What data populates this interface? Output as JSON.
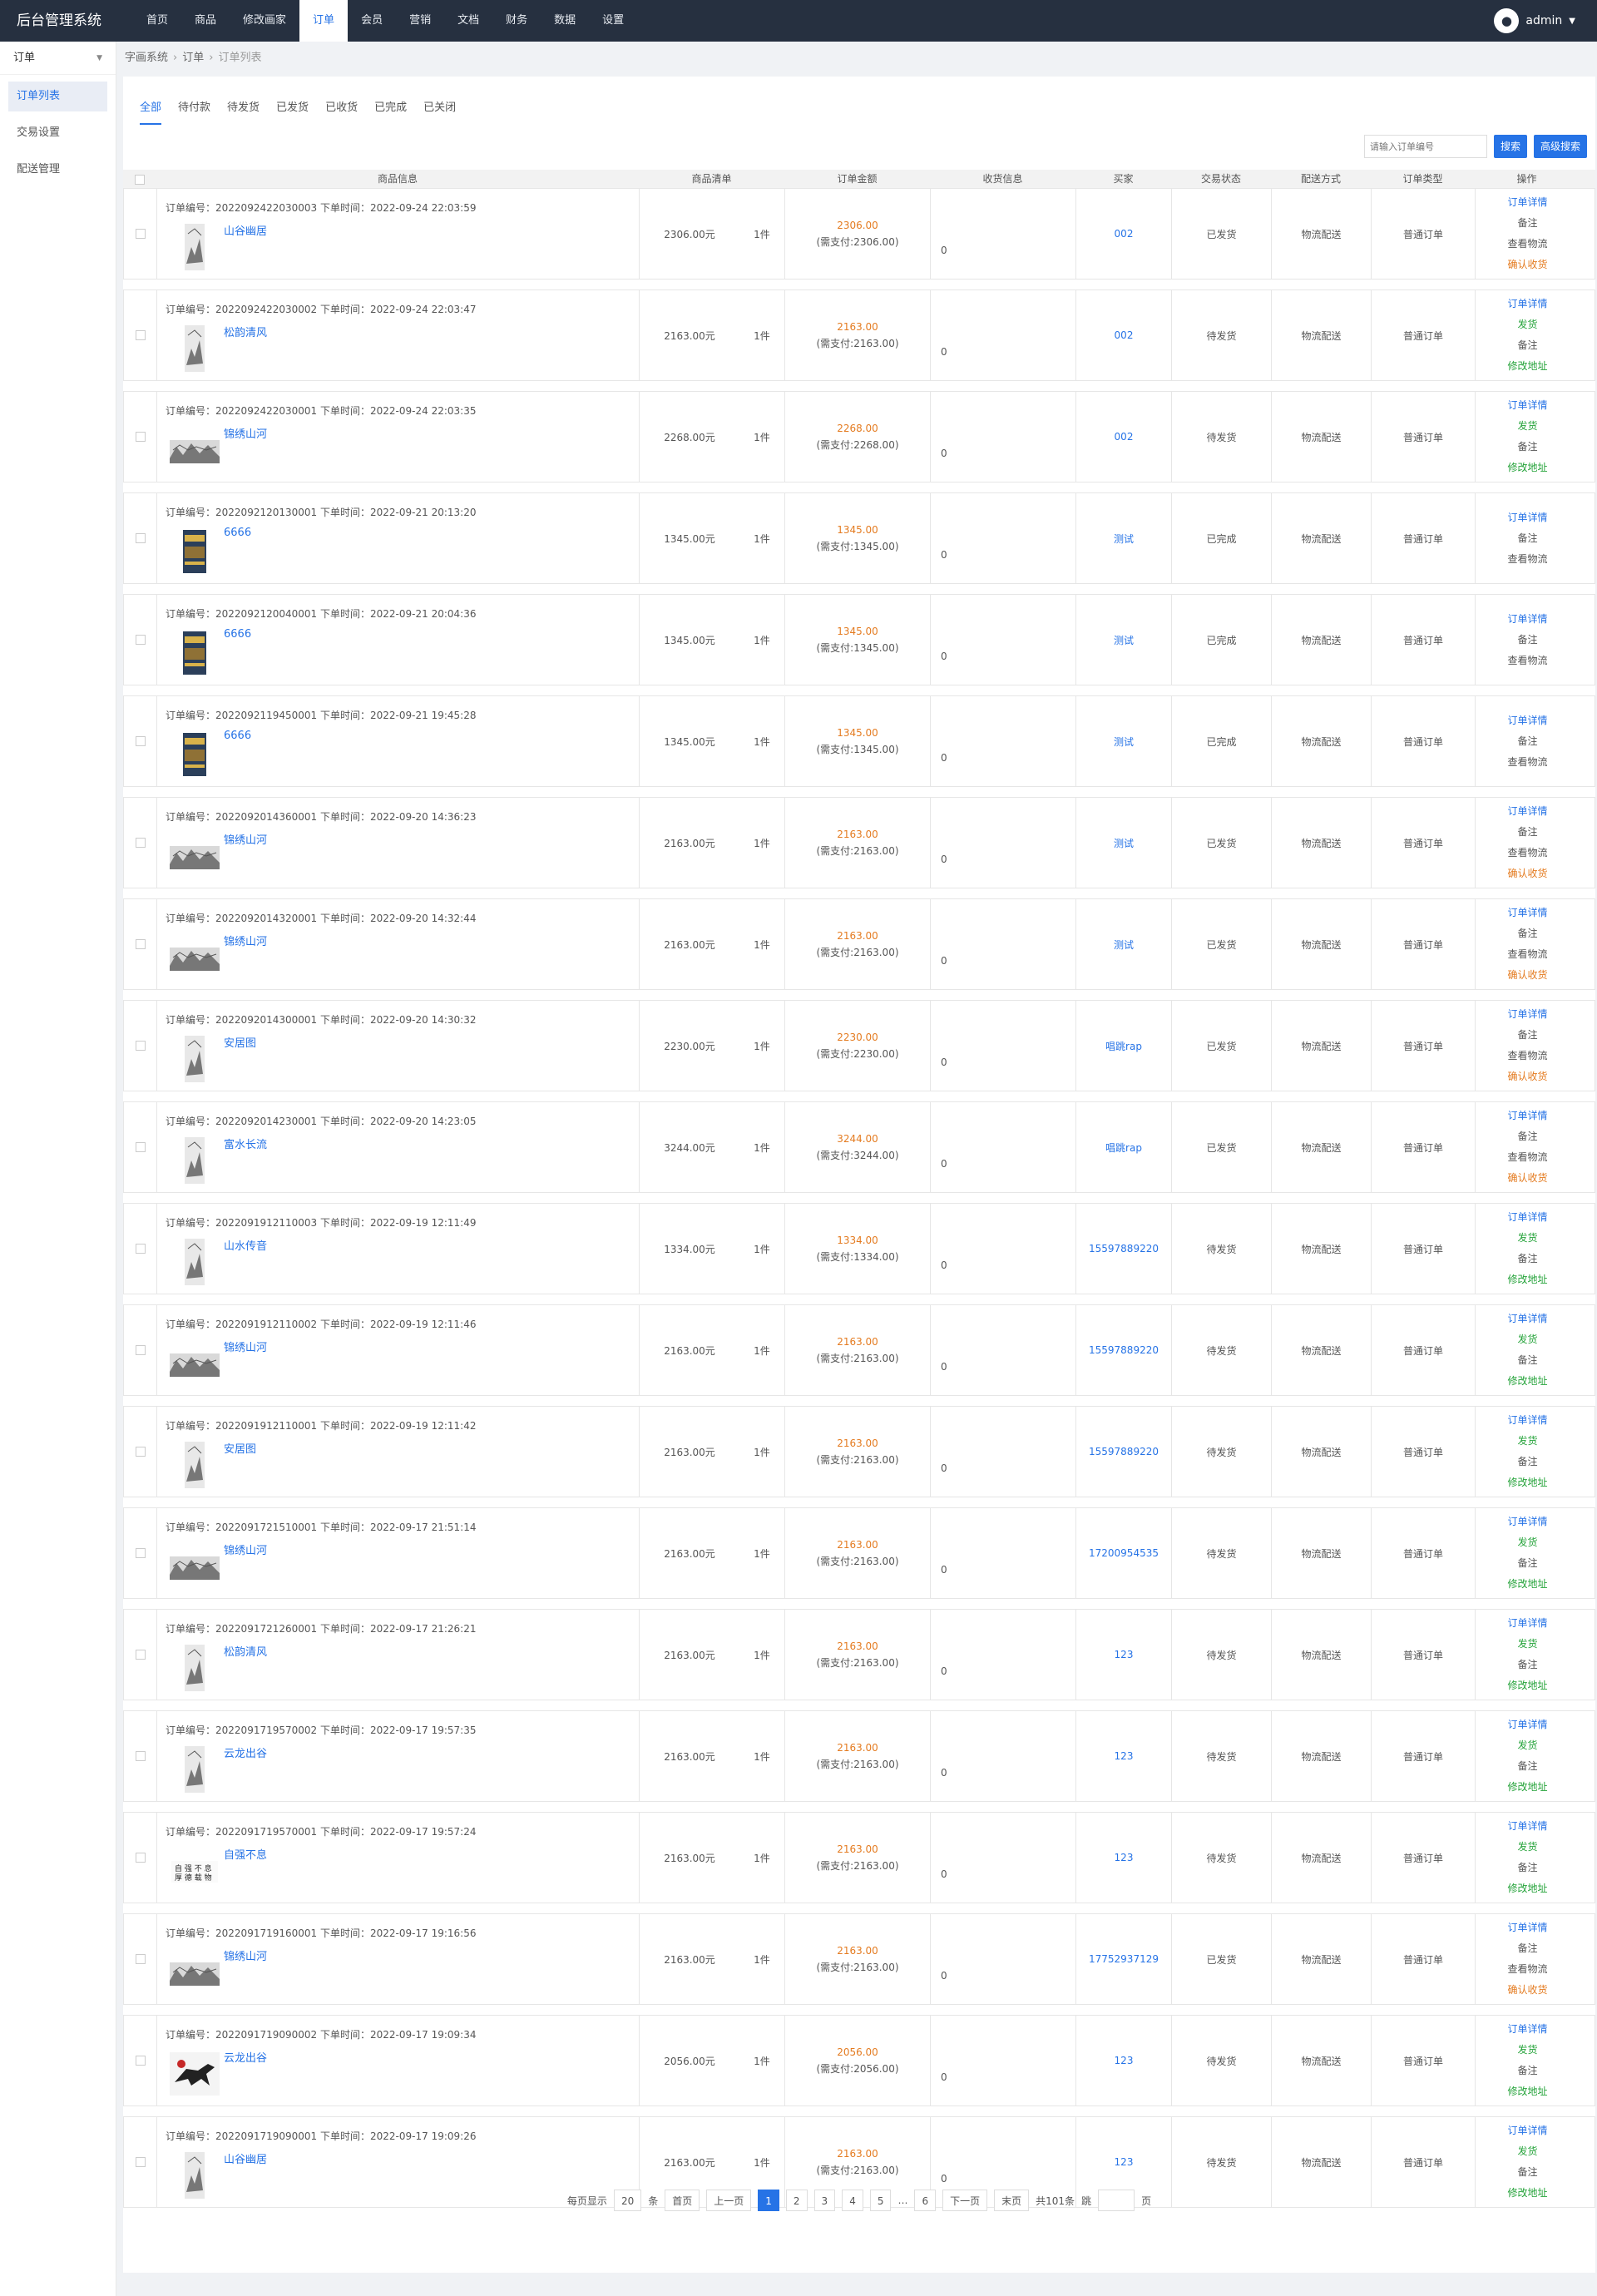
{
  "app": {
    "title": "后台管理系统"
  },
  "topnav": [
    {
      "label": "首页"
    },
    {
      "label": "商品"
    },
    {
      "label": "修改画家"
    },
    {
      "label": "订单",
      "active": true
    },
    {
      "label": "会员"
    },
    {
      "label": "营销"
    },
    {
      "label": "文档"
    },
    {
      "label": "财务"
    },
    {
      "label": "数据"
    },
    {
      "label": "设置"
    }
  ],
  "user": {
    "name": "admin",
    "avatar_icon": "user-icon",
    "caret_icon": "chevron-down-icon"
  },
  "sidebar": {
    "selector": "订单",
    "items": [
      {
        "label": "订单列表",
        "active": true
      },
      {
        "label": "交易设置"
      },
      {
        "label": "配送管理"
      }
    ]
  },
  "breadcrumb": [
    "字画系统",
    "订单",
    "订单列表"
  ],
  "tabs": [
    "全部",
    "待付款",
    "待发货",
    "已发货",
    "已收货",
    "已完成",
    "已关闭"
  ],
  "search": {
    "placeholder": "请输入订单编号",
    "search_btn": "搜索",
    "advanced_btn": "高级搜索"
  },
  "table": {
    "headers": [
      "商品信息",
      "商品清单",
      "订单金额",
      "收货信息",
      "买家",
      "交易状态",
      "配送方式",
      "订单类型",
      "操作"
    ]
  },
  "labels": {
    "order_no": "订单编号：",
    "order_time": "下单时间：",
    "qty": "1件",
    "ship": "物流配送",
    "type": "普通订单",
    "addr": "0",
    "pay_prefix": "(需支付:",
    "pay_suffix": ")"
  },
  "orders": [
    {
      "no": "2022092422030003",
      "time": "2022-09-24 22:03:59",
      "name": "山谷幽居",
      "thumb": "tall",
      "price": "2306.00元",
      "amount": "2306.00",
      "buyer": "002",
      "state": "已发货",
      "ops": [
        "订单详情",
        "备注",
        "查看物流",
        "确认收货"
      ]
    },
    {
      "no": "2022092422030002",
      "time": "2022-09-24 22:03:47",
      "name": "松韵清风",
      "thumb": "tall",
      "price": "2163.00元",
      "amount": "2163.00",
      "buyer": "002",
      "state": "待发货",
      "ops": [
        "订单详情",
        "发货",
        "备注",
        "修改地址"
      ]
    },
    {
      "no": "2022092422030001",
      "time": "2022-09-24 22:03:35",
      "name": "锦绣山河",
      "thumb": "wide",
      "price": "2268.00元",
      "amount": "2268.00",
      "buyer": "002",
      "state": "待发货",
      "ops": [
        "订单详情",
        "发货",
        "备注",
        "修改地址"
      ]
    },
    {
      "no": "2022092120130001",
      "time": "2022-09-21 20:13:20",
      "name": "6666",
      "thumb": "book",
      "price": "1345.00元",
      "amount": "1345.00",
      "buyer": "测试",
      "state": "已完成",
      "ops": [
        "订单详情",
        "备注",
        "查看物流"
      ]
    },
    {
      "no": "2022092120040001",
      "time": "2022-09-21 20:04:36",
      "name": "6666",
      "thumb": "book",
      "price": "1345.00元",
      "amount": "1345.00",
      "buyer": "测试",
      "state": "已完成",
      "ops": [
        "订单详情",
        "备注",
        "查看物流"
      ]
    },
    {
      "no": "2022092119450001",
      "time": "2022-09-21 19:45:28",
      "name": "6666",
      "thumb": "book",
      "price": "1345.00元",
      "amount": "1345.00",
      "buyer": "测试",
      "state": "已完成",
      "ops": [
        "订单详情",
        "备注",
        "查看物流"
      ]
    },
    {
      "no": "2022092014360001",
      "time": "2022-09-20 14:36:23",
      "name": "锦绣山河",
      "thumb": "wide",
      "price": "2163.00元",
      "amount": "2163.00",
      "buyer": "测试",
      "state": "已发货",
      "ops": [
        "订单详情",
        "备注",
        "查看物流",
        "确认收货"
      ]
    },
    {
      "no": "2022092014320001",
      "time": "2022-09-20 14:32:44",
      "name": "锦绣山河",
      "thumb": "wide",
      "price": "2163.00元",
      "amount": "2163.00",
      "buyer": "测试",
      "state": "已发货",
      "ops": [
        "订单详情",
        "备注",
        "查看物流",
        "确认收货"
      ]
    },
    {
      "no": "2022092014300001",
      "time": "2022-09-20 14:30:32",
      "name": "安居图",
      "thumb": "tall",
      "price": "2230.00元",
      "amount": "2230.00",
      "buyer": "唱跳rap",
      "state": "已发货",
      "ops": [
        "订单详情",
        "备注",
        "查看物流",
        "确认收货"
      ]
    },
    {
      "no": "2022092014230001",
      "time": "2022-09-20 14:23:05",
      "name": "富水长流",
      "thumb": "tall",
      "price": "3244.00元",
      "amount": "3244.00",
      "buyer": "唱跳rap",
      "state": "已发货",
      "ops": [
        "订单详情",
        "备注",
        "查看物流",
        "确认收货"
      ]
    },
    {
      "no": "2022091912110003",
      "time": "2022-09-19 12:11:49",
      "name": "山水传音",
      "thumb": "tall",
      "price": "1334.00元",
      "amount": "1334.00",
      "buyer": "15597889220",
      "state": "待发货",
      "ops": [
        "订单详情",
        "发货",
        "备注",
        "修改地址"
      ]
    },
    {
      "no": "2022091912110002",
      "time": "2022-09-19 12:11:46",
      "name": "锦绣山河",
      "thumb": "wide",
      "price": "2163.00元",
      "amount": "2163.00",
      "buyer": "15597889220",
      "state": "待发货",
      "ops": [
        "订单详情",
        "发货",
        "备注",
        "修改地址"
      ]
    },
    {
      "no": "2022091912110001",
      "time": "2022-09-19 12:11:42",
      "name": "安居图",
      "thumb": "tall",
      "price": "2163.00元",
      "amount": "2163.00",
      "buyer": "15597889220",
      "state": "待发货",
      "ops": [
        "订单详情",
        "发货",
        "备注",
        "修改地址"
      ]
    },
    {
      "no": "2022091721510001",
      "time": "2022-09-17 21:51:14",
      "name": "锦绣山河",
      "thumb": "wide",
      "price": "2163.00元",
      "amount": "2163.00",
      "buyer": "17200954535",
      "state": "待发货",
      "ops": [
        "订单详情",
        "发货",
        "备注",
        "修改地址"
      ]
    },
    {
      "no": "2022091721260001",
      "time": "2022-09-17 21:26:21",
      "name": "松韵清风",
      "thumb": "tall",
      "price": "2163.00元",
      "amount": "2163.00",
      "buyer": "123",
      "state": "待发货",
      "ops": [
        "订单详情",
        "发货",
        "备注",
        "修改地址"
      ]
    },
    {
      "no": "2022091719570002",
      "time": "2022-09-17 19:57:35",
      "name": "云龙出谷",
      "thumb": "tall",
      "price": "2163.00元",
      "amount": "2163.00",
      "buyer": "123",
      "state": "待发货",
      "ops": [
        "订单详情",
        "发货",
        "备注",
        "修改地址"
      ]
    },
    {
      "no": "2022091719570001",
      "time": "2022-09-17 19:57:24",
      "name": "自强不息",
      "thumb": "calli",
      "price": "2163.00元",
      "amount": "2163.00",
      "buyer": "123",
      "state": "待发货",
      "ops": [
        "订单详情",
        "发货",
        "备注",
        "修改地址"
      ]
    },
    {
      "no": "2022091719160001",
      "time": "2022-09-17 19:16:56",
      "name": "锦绣山河",
      "thumb": "wide",
      "price": "2163.00元",
      "amount": "2163.00",
      "buyer": "17752937129",
      "state": "已发货",
      "ops": [
        "订单详情",
        "备注",
        "查看物流",
        "确认收货"
      ]
    },
    {
      "no": "2022091719090002",
      "time": "2022-09-17 19:09:34",
      "name": "云龙出谷",
      "thumb": "horse",
      "price": "2056.00元",
      "amount": "2056.00",
      "buyer": "123",
      "state": "待发货",
      "ops": [
        "订单详情",
        "发货",
        "备注",
        "修改地址"
      ]
    },
    {
      "no": "2022091719090001",
      "time": "2022-09-17 19:09:26",
      "name": "山谷幽居",
      "thumb": "tall",
      "price": "2163.00元",
      "amount": "2163.00",
      "buyer": "123",
      "state": "待发货",
      "ops": [
        "订单详情",
        "发货",
        "备注",
        "修改地址"
      ]
    }
  ],
  "pager": {
    "per_page_label": "每页显示",
    "per_page": "20",
    "per_page_unit": "条",
    "first": "首页",
    "prev": "上一页",
    "pages": [
      "1",
      "2",
      "3",
      "4",
      "5"
    ],
    "ellipsis": "…",
    "last_page": "6",
    "next": "下一页",
    "last": "末页",
    "total": "共101条",
    "jump": "跳",
    "page_unit": "页"
  },
  "colors": {
    "topbar": "#263040",
    "accent": "#2673e6",
    "orange": "#e47b20",
    "green": "#25a33a"
  }
}
